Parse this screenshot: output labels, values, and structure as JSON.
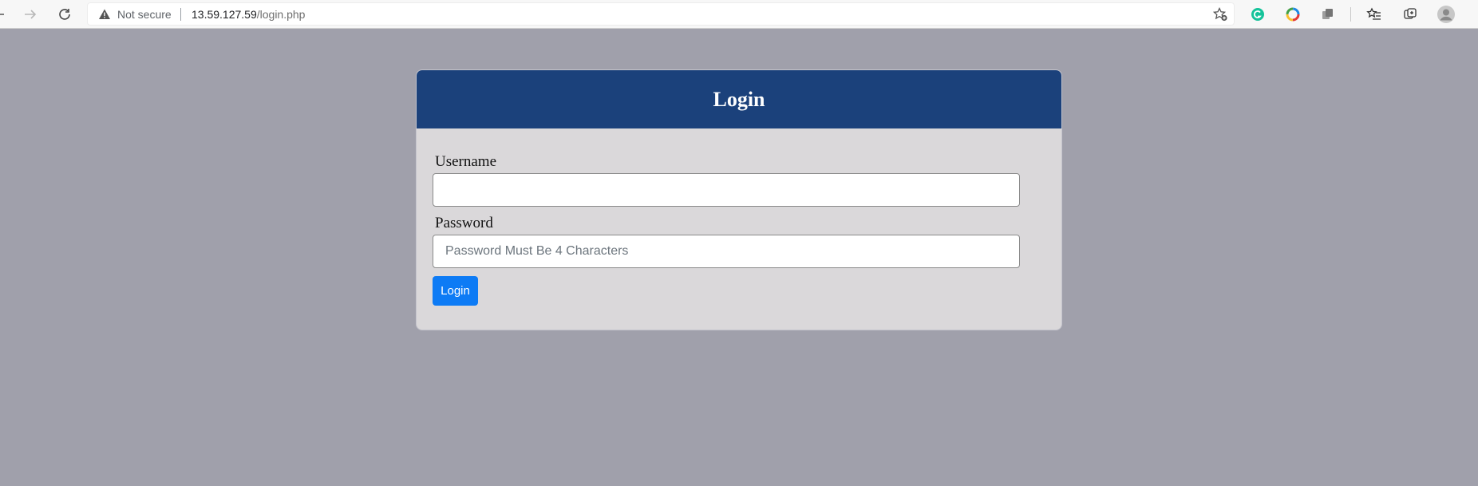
{
  "browser": {
    "security_label": "Not secure",
    "url_host": "13.59.127.59",
    "url_path": "/login.php",
    "icons": [
      "back-icon",
      "forward-icon",
      "reload-icon",
      "warning-icon",
      "add-favorite-icon",
      "grammarly-icon",
      "color-wheel-extension-icon",
      "extension-icon",
      "favorites-icon",
      "collections-icon",
      "profile-icon"
    ]
  },
  "colors": {
    "page_background": "#a0a0ab",
    "header": "#1b417b",
    "card": "#dad8da",
    "button": "#0d7bf5"
  },
  "login": {
    "title": "Login",
    "username_label": "Username",
    "username_value": "",
    "password_label": "Password",
    "password_placeholder": "Password Must Be 4 Characters",
    "submit_label": "Login"
  }
}
